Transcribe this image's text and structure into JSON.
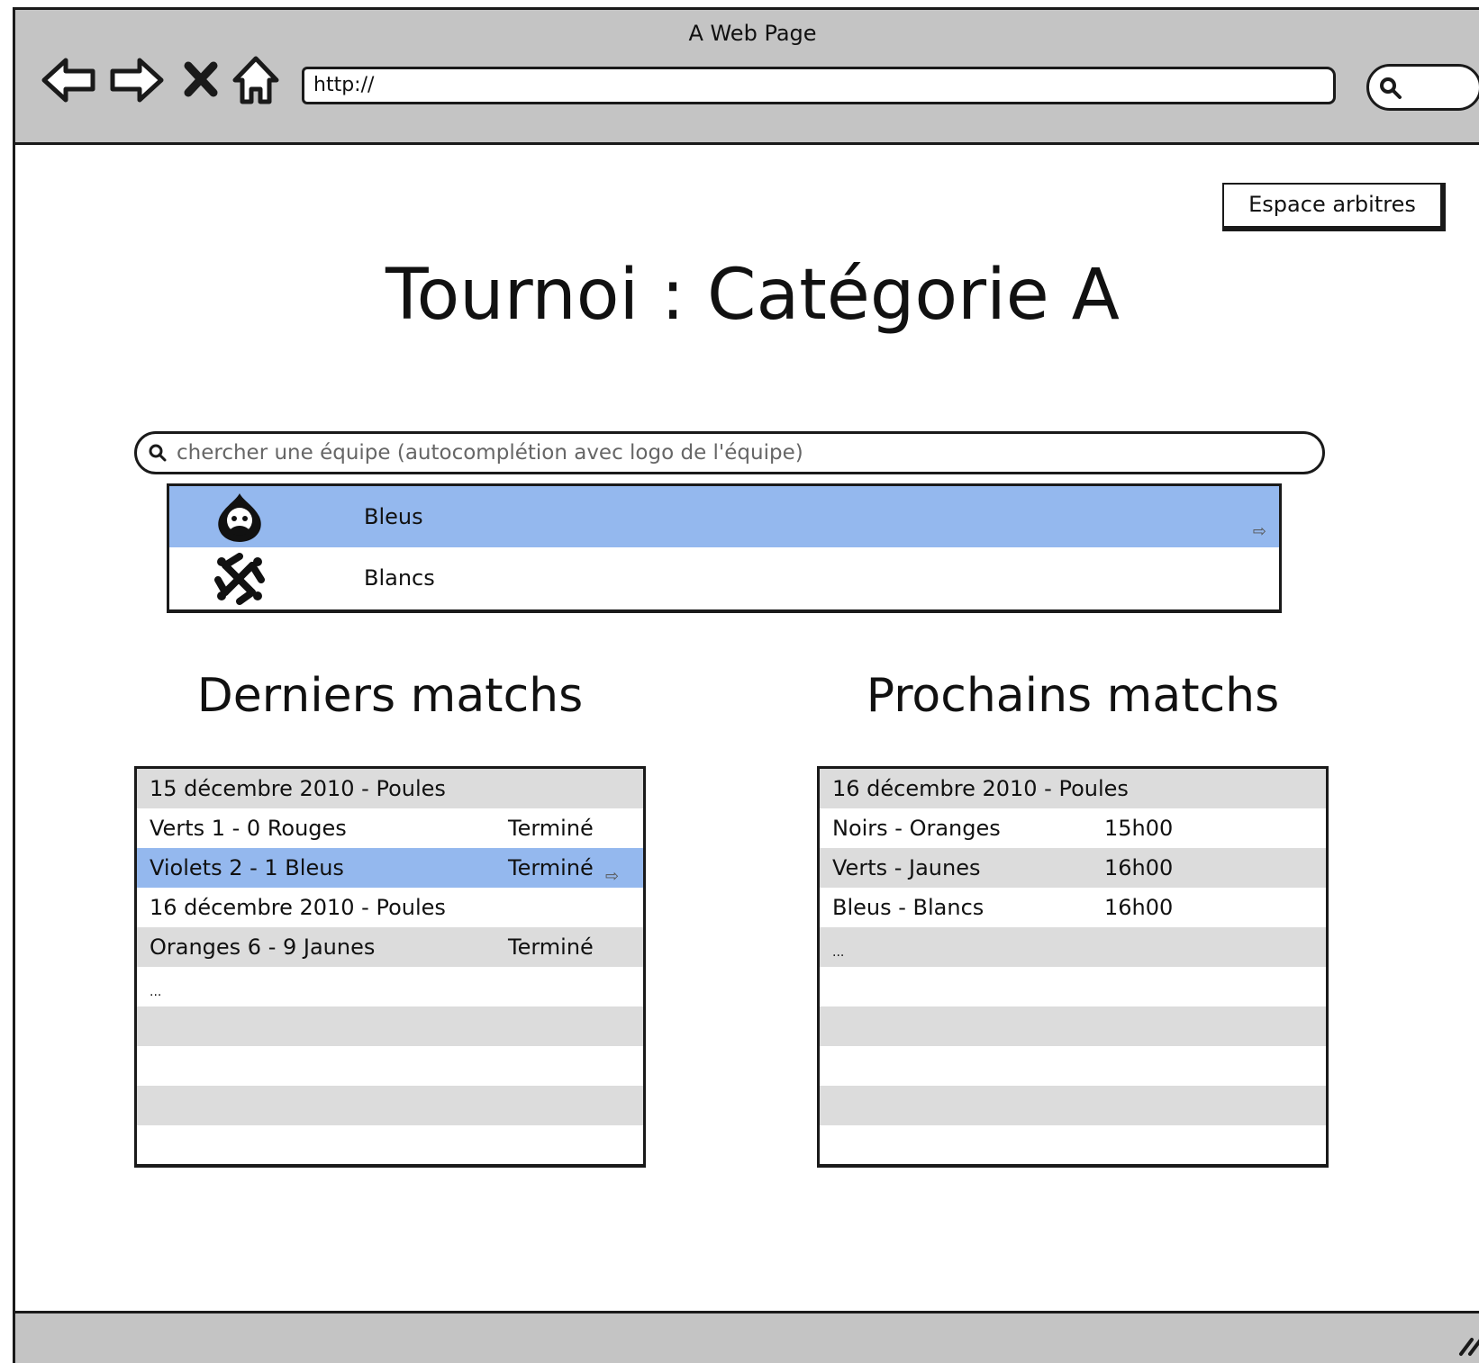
{
  "window": {
    "title": "A Web Page"
  },
  "browser": {
    "url": "http://",
    "nav": [
      "back-arrow-icon",
      "forward-arrow-icon",
      "stop-icon",
      "home-icon"
    ],
    "search_icon": "search-icon"
  },
  "header": {
    "referee_button": "Espace arbitres"
  },
  "page": {
    "title": "Tournoi : Catégorie A"
  },
  "team_search": {
    "placeholder": "chercher une équipe (autocomplétion avec logo de l'équipe)",
    "results": [
      {
        "label": "Bleus",
        "logo": "drupal-drop-icon",
        "selected": true
      },
      {
        "label": "Blancs",
        "logo": "joomla-logo-icon",
        "selected": false
      }
    ]
  },
  "last_matches": {
    "title": "Derniers matchs",
    "rows": [
      {
        "match": "15 décembre 2010 - Poules",
        "status": ""
      },
      {
        "match": "Verts 1 - 0 Rouges",
        "status": "Terminé"
      },
      {
        "match": "Violets 2 - 1 Bleus",
        "status": "Terminé",
        "selected": true
      },
      {
        "match": "16 décembre 2010 - Poules",
        "status": ""
      },
      {
        "match": "Oranges 6 - 9 Jaunes",
        "status": "Terminé"
      },
      {
        "match": "...",
        "status": ""
      }
    ]
  },
  "next_matches": {
    "title": "Prochains matchs",
    "rows": [
      {
        "match": "16 décembre 2010 - Poules",
        "time": ""
      },
      {
        "match": "Noirs - Oranges",
        "time": "15h00"
      },
      {
        "match": "Verts - Jaunes",
        "time": "16h00"
      },
      {
        "match": "Bleus - Blancs",
        "time": "16h00"
      },
      {
        "match": "...",
        "time": ""
      }
    ]
  },
  "colors": {
    "chrome": "#c4c4c4",
    "selection": "#94b8ee",
    "stripe": "#dcdcdc"
  }
}
